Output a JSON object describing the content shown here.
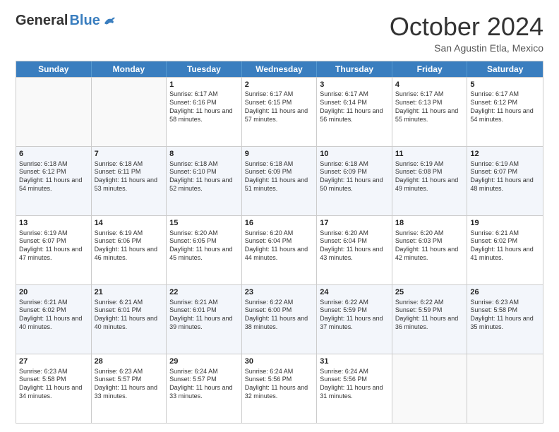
{
  "header": {
    "logo": {
      "general": "General",
      "blue": "Blue"
    },
    "title": "October 2024",
    "location": "San Agustin Etla, Mexico"
  },
  "days": [
    "Sunday",
    "Monday",
    "Tuesday",
    "Wednesday",
    "Thursday",
    "Friday",
    "Saturday"
  ],
  "rows": [
    [
      {
        "day": "",
        "sunrise": "",
        "sunset": "",
        "daylight": "",
        "empty": true
      },
      {
        "day": "",
        "sunrise": "",
        "sunset": "",
        "daylight": "",
        "empty": true
      },
      {
        "day": "1",
        "sunrise": "Sunrise: 6:17 AM",
        "sunset": "Sunset: 6:16 PM",
        "daylight": "Daylight: 11 hours and 58 minutes."
      },
      {
        "day": "2",
        "sunrise": "Sunrise: 6:17 AM",
        "sunset": "Sunset: 6:15 PM",
        "daylight": "Daylight: 11 hours and 57 minutes."
      },
      {
        "day": "3",
        "sunrise": "Sunrise: 6:17 AM",
        "sunset": "Sunset: 6:14 PM",
        "daylight": "Daylight: 11 hours and 56 minutes."
      },
      {
        "day": "4",
        "sunrise": "Sunrise: 6:17 AM",
        "sunset": "Sunset: 6:13 PM",
        "daylight": "Daylight: 11 hours and 55 minutes."
      },
      {
        "day": "5",
        "sunrise": "Sunrise: 6:17 AM",
        "sunset": "Sunset: 6:12 PM",
        "daylight": "Daylight: 11 hours and 54 minutes."
      }
    ],
    [
      {
        "day": "6",
        "sunrise": "Sunrise: 6:18 AM",
        "sunset": "Sunset: 6:12 PM",
        "daylight": "Daylight: 11 hours and 54 minutes."
      },
      {
        "day": "7",
        "sunrise": "Sunrise: 6:18 AM",
        "sunset": "Sunset: 6:11 PM",
        "daylight": "Daylight: 11 hours and 53 minutes."
      },
      {
        "day": "8",
        "sunrise": "Sunrise: 6:18 AM",
        "sunset": "Sunset: 6:10 PM",
        "daylight": "Daylight: 11 hours and 52 minutes."
      },
      {
        "day": "9",
        "sunrise": "Sunrise: 6:18 AM",
        "sunset": "Sunset: 6:09 PM",
        "daylight": "Daylight: 11 hours and 51 minutes."
      },
      {
        "day": "10",
        "sunrise": "Sunrise: 6:18 AM",
        "sunset": "Sunset: 6:09 PM",
        "daylight": "Daylight: 11 hours and 50 minutes."
      },
      {
        "day": "11",
        "sunrise": "Sunrise: 6:19 AM",
        "sunset": "Sunset: 6:08 PM",
        "daylight": "Daylight: 11 hours and 49 minutes."
      },
      {
        "day": "12",
        "sunrise": "Sunrise: 6:19 AM",
        "sunset": "Sunset: 6:07 PM",
        "daylight": "Daylight: 11 hours and 48 minutes."
      }
    ],
    [
      {
        "day": "13",
        "sunrise": "Sunrise: 6:19 AM",
        "sunset": "Sunset: 6:07 PM",
        "daylight": "Daylight: 11 hours and 47 minutes."
      },
      {
        "day": "14",
        "sunrise": "Sunrise: 6:19 AM",
        "sunset": "Sunset: 6:06 PM",
        "daylight": "Daylight: 11 hours and 46 minutes."
      },
      {
        "day": "15",
        "sunrise": "Sunrise: 6:20 AM",
        "sunset": "Sunset: 6:05 PM",
        "daylight": "Daylight: 11 hours and 45 minutes."
      },
      {
        "day": "16",
        "sunrise": "Sunrise: 6:20 AM",
        "sunset": "Sunset: 6:04 PM",
        "daylight": "Daylight: 11 hours and 44 minutes."
      },
      {
        "day": "17",
        "sunrise": "Sunrise: 6:20 AM",
        "sunset": "Sunset: 6:04 PM",
        "daylight": "Daylight: 11 hours and 43 minutes."
      },
      {
        "day": "18",
        "sunrise": "Sunrise: 6:20 AM",
        "sunset": "Sunset: 6:03 PM",
        "daylight": "Daylight: 11 hours and 42 minutes."
      },
      {
        "day": "19",
        "sunrise": "Sunrise: 6:21 AM",
        "sunset": "Sunset: 6:02 PM",
        "daylight": "Daylight: 11 hours and 41 minutes."
      }
    ],
    [
      {
        "day": "20",
        "sunrise": "Sunrise: 6:21 AM",
        "sunset": "Sunset: 6:02 PM",
        "daylight": "Daylight: 11 hours and 40 minutes."
      },
      {
        "day": "21",
        "sunrise": "Sunrise: 6:21 AM",
        "sunset": "Sunset: 6:01 PM",
        "daylight": "Daylight: 11 hours and 40 minutes."
      },
      {
        "day": "22",
        "sunrise": "Sunrise: 6:21 AM",
        "sunset": "Sunset: 6:01 PM",
        "daylight": "Daylight: 11 hours and 39 minutes."
      },
      {
        "day": "23",
        "sunrise": "Sunrise: 6:22 AM",
        "sunset": "Sunset: 6:00 PM",
        "daylight": "Daylight: 11 hours and 38 minutes."
      },
      {
        "day": "24",
        "sunrise": "Sunrise: 6:22 AM",
        "sunset": "Sunset: 5:59 PM",
        "daylight": "Daylight: 11 hours and 37 minutes."
      },
      {
        "day": "25",
        "sunrise": "Sunrise: 6:22 AM",
        "sunset": "Sunset: 5:59 PM",
        "daylight": "Daylight: 11 hours and 36 minutes."
      },
      {
        "day": "26",
        "sunrise": "Sunrise: 6:23 AM",
        "sunset": "Sunset: 5:58 PM",
        "daylight": "Daylight: 11 hours and 35 minutes."
      }
    ],
    [
      {
        "day": "27",
        "sunrise": "Sunrise: 6:23 AM",
        "sunset": "Sunset: 5:58 PM",
        "daylight": "Daylight: 11 hours and 34 minutes."
      },
      {
        "day": "28",
        "sunrise": "Sunrise: 6:23 AM",
        "sunset": "Sunset: 5:57 PM",
        "daylight": "Daylight: 11 hours and 33 minutes."
      },
      {
        "day": "29",
        "sunrise": "Sunrise: 6:24 AM",
        "sunset": "Sunset: 5:57 PM",
        "daylight": "Daylight: 11 hours and 33 minutes."
      },
      {
        "day": "30",
        "sunrise": "Sunrise: 6:24 AM",
        "sunset": "Sunset: 5:56 PM",
        "daylight": "Daylight: 11 hours and 32 minutes."
      },
      {
        "day": "31",
        "sunrise": "Sunrise: 6:24 AM",
        "sunset": "Sunset: 5:56 PM",
        "daylight": "Daylight: 11 hours and 31 minutes."
      },
      {
        "day": "",
        "sunrise": "",
        "sunset": "",
        "daylight": "",
        "empty": true
      },
      {
        "day": "",
        "sunrise": "",
        "sunset": "",
        "daylight": "",
        "empty": true
      }
    ]
  ]
}
